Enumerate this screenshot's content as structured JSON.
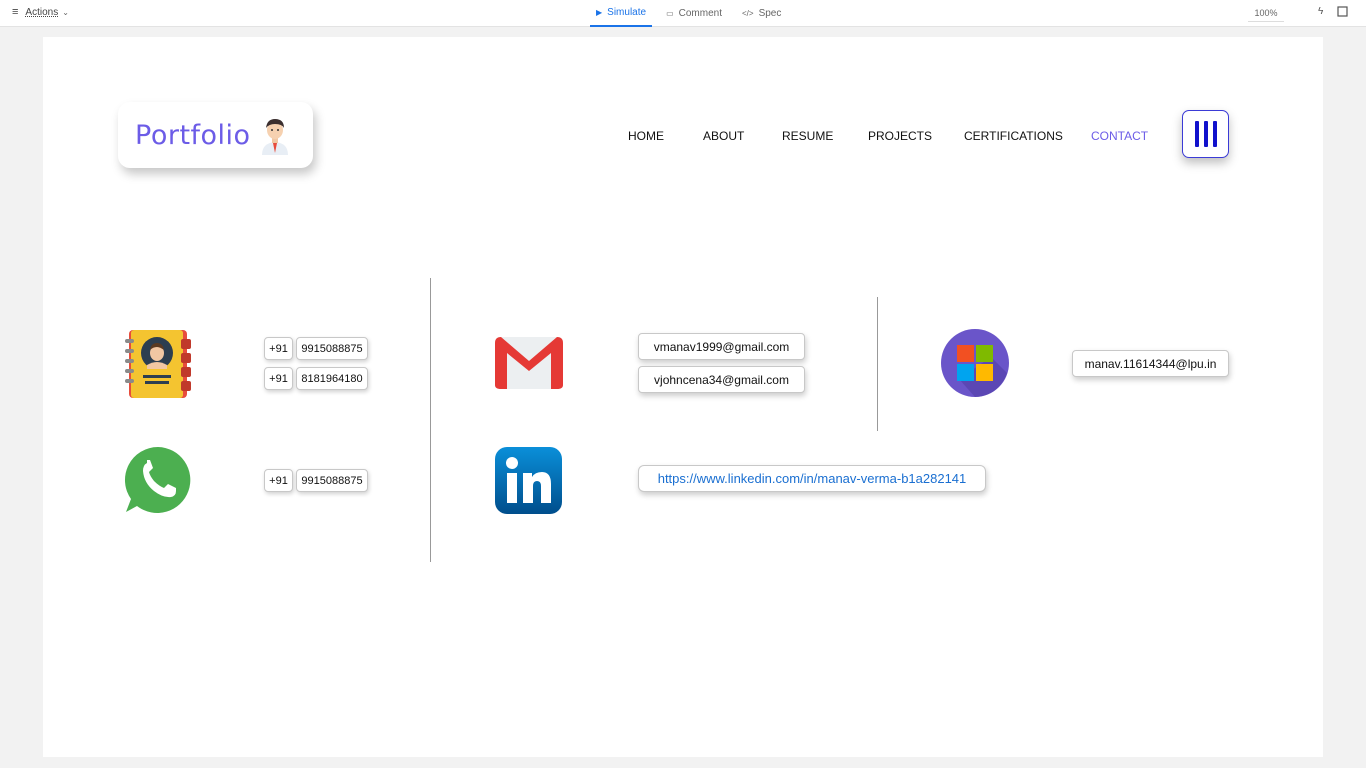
{
  "toolbar": {
    "actions_label": "Actions",
    "tabs": [
      {
        "label": "Simulate",
        "icon": "play-icon",
        "active": true
      },
      {
        "label": "Comment",
        "icon": "comment-icon",
        "active": false
      },
      {
        "label": "Spec",
        "icon": "code-icon",
        "active": false
      }
    ],
    "zoom": "100%"
  },
  "logo": {
    "text": "Portfolio"
  },
  "nav": {
    "items": [
      {
        "label": "HOME",
        "active": false
      },
      {
        "label": "ABOUT",
        "active": false
      },
      {
        "label": "RESUME",
        "active": false
      },
      {
        "label": "PROJECTS",
        "active": false
      },
      {
        "label": "CERTIFICATIONS",
        "active": false
      },
      {
        "label": "CONTACT",
        "active": true
      }
    ],
    "active_color": "#6c5ce7"
  },
  "contact": {
    "phone": {
      "code": "+91",
      "numbers": [
        "9915088875",
        "8181964180"
      ]
    },
    "whatsapp": {
      "code": "+91",
      "number": "9915088875"
    },
    "gmail": [
      "vmanav1999@gmail.com",
      "vjohncena34@gmail.com"
    ],
    "microsoft": "manav.11614344@lpu.in",
    "linkedin": "https://www.linkedin.com/in/manav-verma-b1a282141"
  },
  "colors": {
    "accent": "#6c5ce7",
    "menu_bars": "#1111cc",
    "link": "#1a6fd1"
  }
}
